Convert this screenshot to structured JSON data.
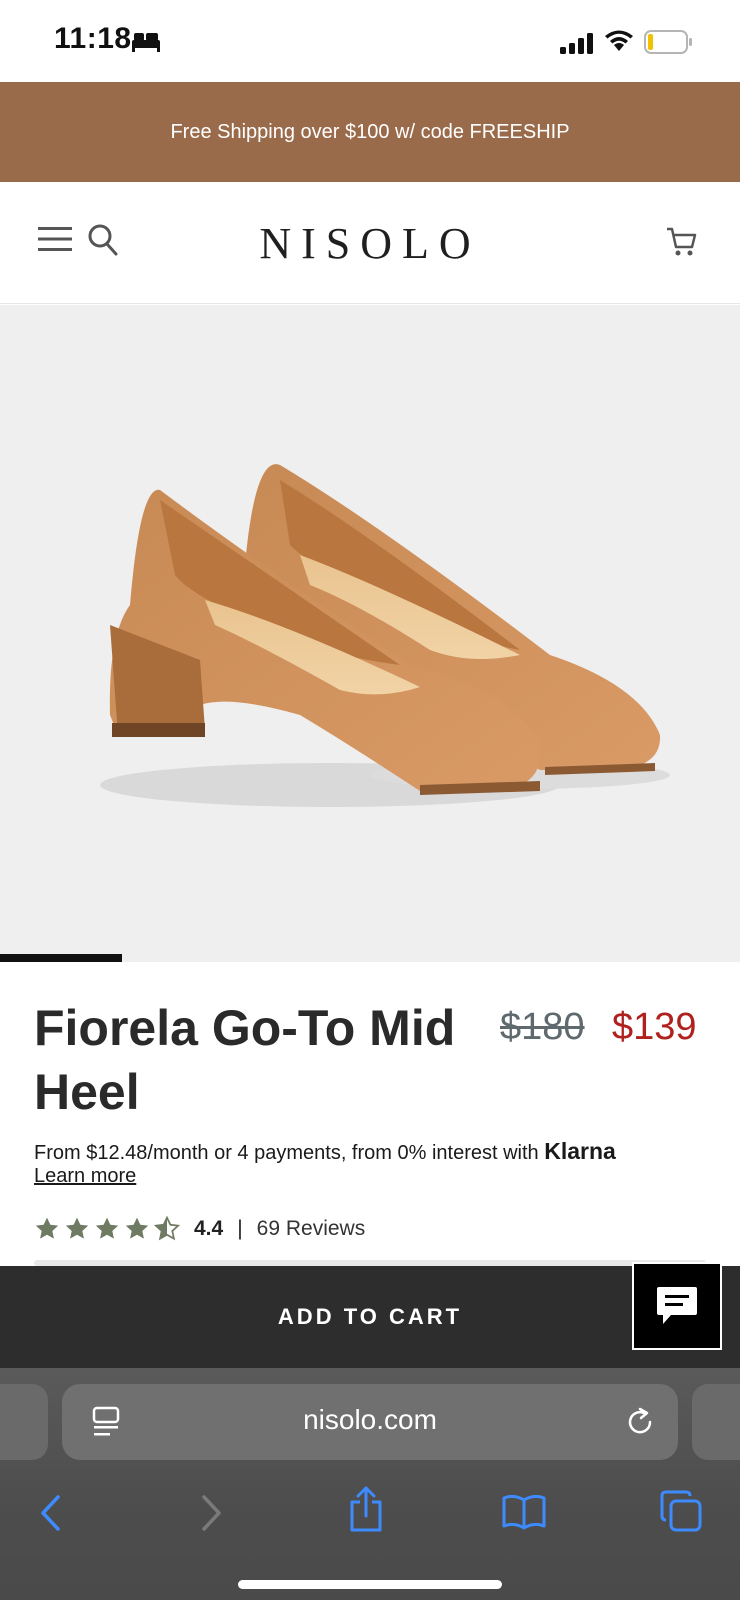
{
  "status_bar": {
    "time": "11:18"
  },
  "promo": {
    "text": "Free Shipping over $100 w/ code FREESHIP"
  },
  "header": {
    "logo": "NISOLO"
  },
  "carousel": {
    "progress": 0.165
  },
  "product": {
    "title": "Fiorela Go-To Mid Heel",
    "price_original": "$180",
    "price_sale": "$139",
    "financing_text": "From $12.48/month or 4 payments, from 0% interest with ",
    "financing_brand": "Klarna",
    "learn_more": "Learn more",
    "rating": "4.4",
    "rating_separator": "|",
    "reviews": "69 Reviews",
    "stars_filled": 4.5
  },
  "cta": {
    "add_to_cart": "ADD TO CART"
  },
  "browser": {
    "url": "nisolo.com"
  },
  "colors": {
    "promo_bg": "#9a6b4b",
    "sale_price": "#b0211e",
    "star": "#6f7a63",
    "cta_bg": "#2d2d2d",
    "safari_accent": "#3d8bff"
  }
}
